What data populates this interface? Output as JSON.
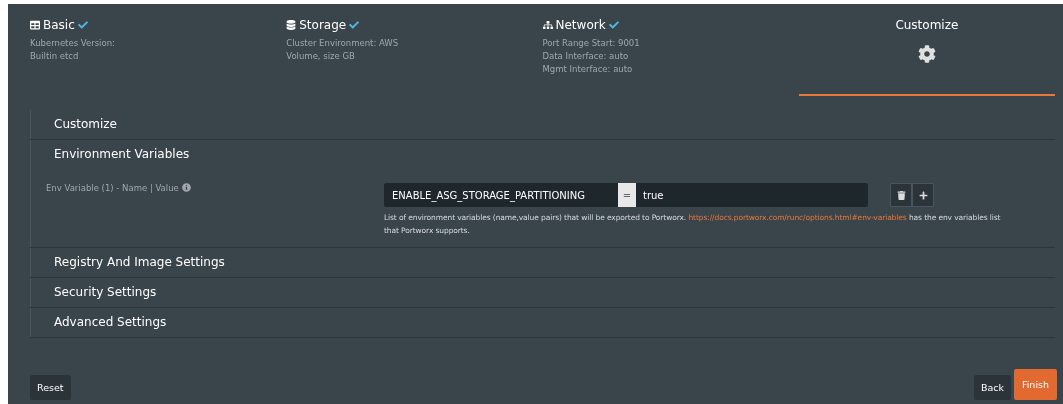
{
  "steps": [
    {
      "kind": "basic",
      "title": "Basic",
      "done": true,
      "selected": false,
      "details": [
        "Kubernetes Version:",
        "Builtin etcd"
      ]
    },
    {
      "kind": "storage",
      "title": "Storage",
      "done": true,
      "selected": false,
      "details": [
        "Cluster Environment: AWS",
        "Volume, size GB"
      ]
    },
    {
      "kind": "network",
      "title": "Network",
      "done": true,
      "selected": false,
      "details": [
        "Port Range Start: 9001",
        "Data Interface: auto",
        "Mgmt Interface: auto"
      ]
    },
    {
      "kind": "customize",
      "title": "Customize",
      "done": false,
      "selected": true
    }
  ],
  "sections": [
    {
      "title": "Customize",
      "expanded": false
    },
    {
      "title": "Environment Variables",
      "expanded": true,
      "field_label": "Env Variable (1) - Name | Value",
      "env": {
        "name": "ENABLE_ASG_STORAGE_PARTITIONING",
        "separator": "=",
        "value": "true"
      },
      "help_before": "List of environment variables (name,value pairs) that will be exported to Portworx.",
      "help_link": "https://docs.portworx.com/runc/options.html#env-variables",
      "help_after": "has the env variables list that Portworx supports."
    },
    {
      "title": "Registry And Image Settings",
      "expanded": false
    },
    {
      "title": "Security Settings",
      "expanded": false
    },
    {
      "title": "Advanced Settings",
      "expanded": false
    }
  ],
  "footer": {
    "reset": "Reset",
    "back": "Back",
    "finish": "Finish"
  }
}
